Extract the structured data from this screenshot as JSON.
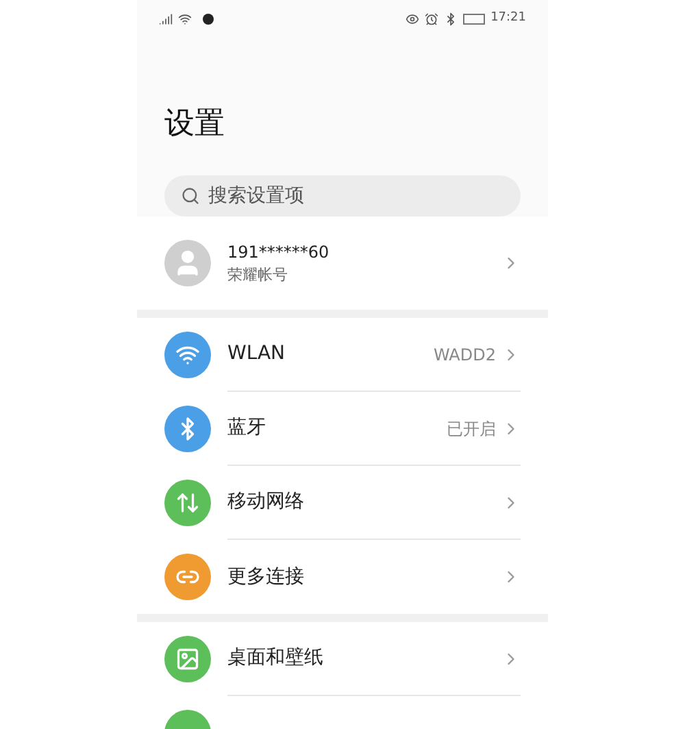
{
  "status_bar": {
    "time": "17:21"
  },
  "title": "设置",
  "search": {
    "placeholder": "搜索设置项"
  },
  "account": {
    "name": "191******60",
    "subtitle": "荣耀帐号"
  },
  "groups": [
    {
      "items": [
        {
          "color": "#4a9fe6",
          "label": "WLAN",
          "value": "WADD2"
        },
        {
          "color": "#4a9fe6",
          "label": "蓝牙",
          "value": "已开启"
        },
        {
          "color": "#5cbf5a",
          "label": "移动网络"
        },
        {
          "color": "#f09a32",
          "label": "更多连接"
        }
      ]
    },
    {
      "items": [
        {
          "color": "#5cbf5a",
          "label": "桌面和壁纸"
        },
        {
          "color": "#5cbf5a"
        }
      ]
    }
  ]
}
